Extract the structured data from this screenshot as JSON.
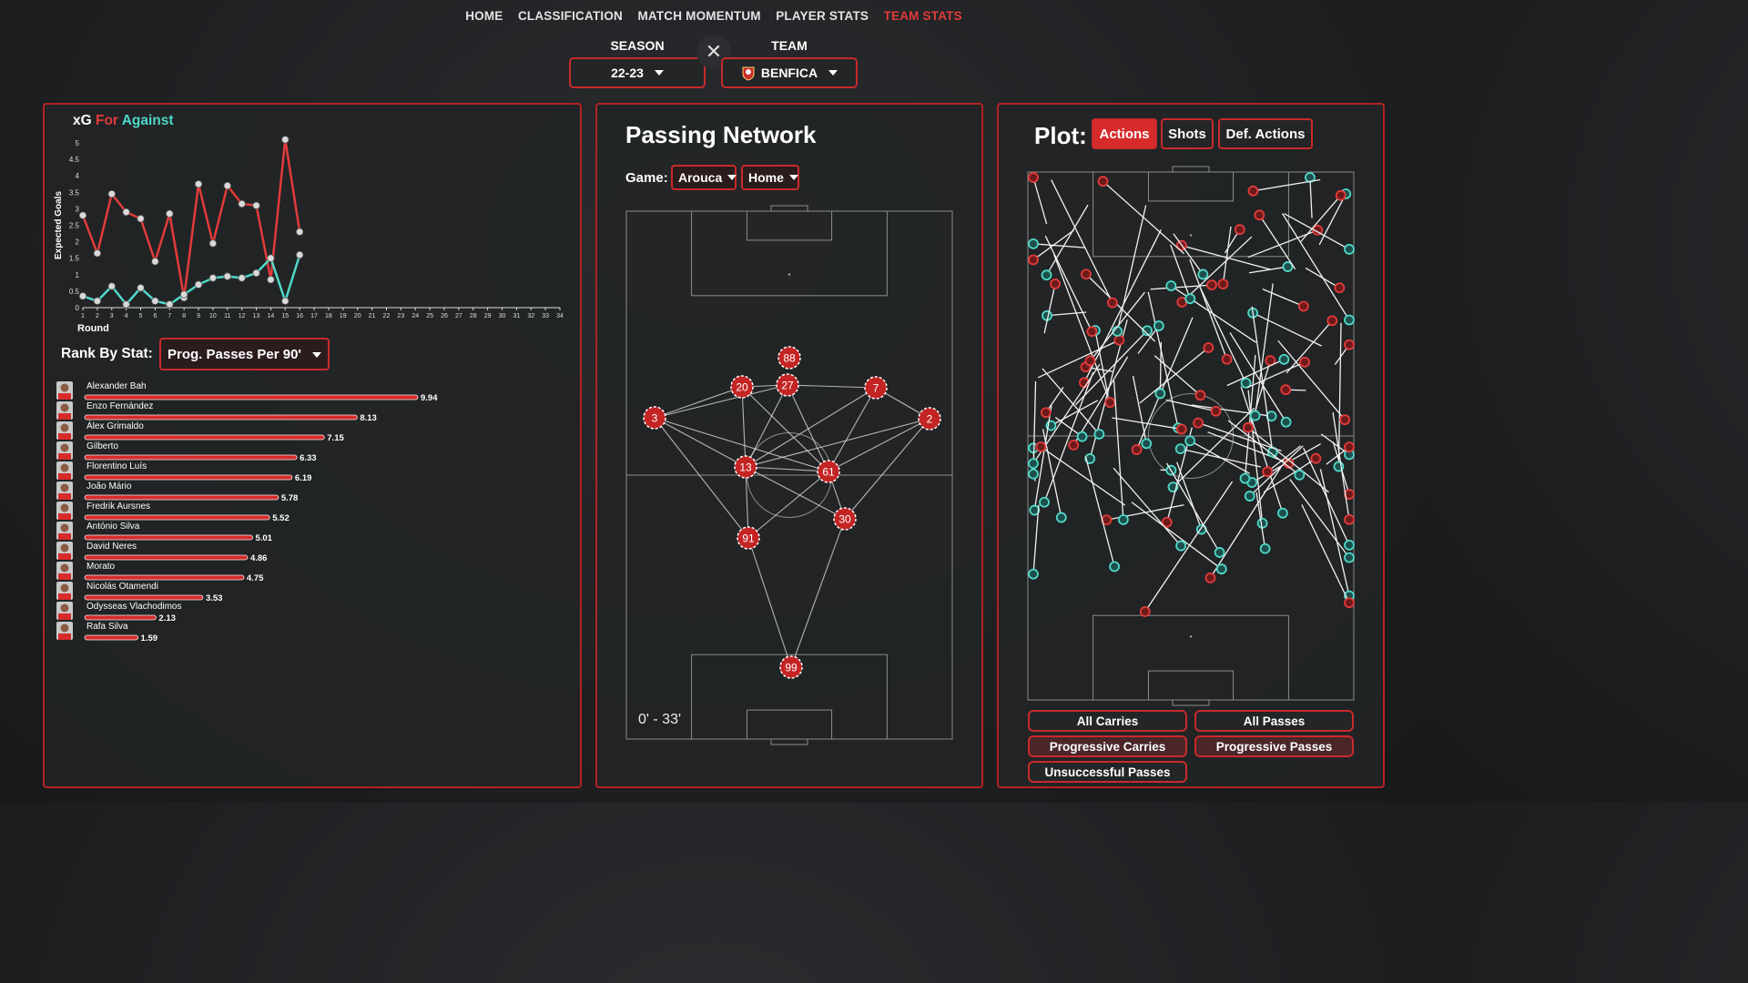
{
  "nav": {
    "items": [
      {
        "label": "HOME",
        "active": false
      },
      {
        "label": "CLASSIFICATION",
        "active": false
      },
      {
        "label": "MATCH MOMENTUM",
        "active": false
      },
      {
        "label": "PLAYER STATS",
        "active": false
      },
      {
        "label": "TEAM STATS",
        "active": true
      }
    ]
  },
  "filters": {
    "season_label": "SEASON",
    "season_value": "22-23",
    "team_label": "TEAM",
    "team_value": "BENFICA",
    "clear_symbol": "✕"
  },
  "colors": {
    "accent": "#d72b2b",
    "for": "#e23b3b",
    "against": "#4fd8c8",
    "panel_border": "#b32222"
  },
  "xg": {
    "title_prefix": "xG",
    "for_label": "For",
    "against_label": "Against",
    "ylabel": "Expected Goals",
    "xlabel": "Round"
  },
  "chart_data": {
    "type": "line",
    "x": [
      1,
      2,
      3,
      4,
      5,
      6,
      7,
      8,
      9,
      10,
      11,
      12,
      13,
      14,
      15,
      16
    ],
    "x_ticks": [
      1,
      2,
      3,
      4,
      5,
      6,
      7,
      8,
      9,
      10,
      11,
      12,
      13,
      14,
      15,
      16,
      17,
      18,
      19,
      20,
      21,
      22,
      23,
      24,
      25,
      26,
      27,
      28,
      29,
      30,
      31,
      32,
      33,
      34
    ],
    "y_ticks": [
      "0",
      "0.5",
      "1",
      "1.5",
      "2",
      "2.5",
      "3",
      "3.5",
      "4",
      "4.5",
      "5"
    ],
    "ylim": [
      0,
      5
    ],
    "xlim": [
      1,
      34
    ],
    "series": [
      {
        "name": "For",
        "values": [
          2.8,
          1.65,
          3.45,
          2.9,
          2.7,
          1.4,
          2.85,
          0.3,
          3.75,
          1.95,
          3.7,
          3.15,
          3.1,
          0.85,
          5.1,
          2.3
        ]
      },
      {
        "name": "Against",
        "values": [
          0.35,
          0.2,
          0.65,
          0.1,
          0.6,
          0.2,
          0.1,
          0.4,
          0.7,
          0.9,
          0.95,
          0.9,
          1.05,
          1.5,
          0.2,
          1.6
        ]
      }
    ]
  },
  "rank": {
    "label": "Rank By Stat:",
    "selected": "Prog. Passes Per 90'",
    "max": 9.94,
    "players": [
      {
        "name": "Alexander Bah",
        "value": 9.94
      },
      {
        "name": "Enzo Fernández",
        "value": 8.13
      },
      {
        "name": "Álex Grimaldo",
        "value": 7.15
      },
      {
        "name": "Gilberto",
        "value": 6.33
      },
      {
        "name": "Florentino Luís",
        "value": 6.19
      },
      {
        "name": "João Mário",
        "value": 5.78
      },
      {
        "name": "Fredrik Aursnes",
        "value": 5.52
      },
      {
        "name": "António Silva",
        "value": 5.01
      },
      {
        "name": "David Neres",
        "value": 4.86
      },
      {
        "name": "Morato",
        "value": 4.75
      },
      {
        "name": "Nicolás Otamendi",
        "value": 3.53
      },
      {
        "name": "Odysseas Vlachodimos",
        "value": 2.13
      },
      {
        "name": "Rafa Silva",
        "value": 1.59
      }
    ]
  },
  "passing": {
    "title": "Passing Network",
    "game_label": "Game:",
    "game_value": "Arouca",
    "venue_value": "Home",
    "time_range": "0' - 33'",
    "nodes": [
      {
        "num": "88"
      },
      {
        "num": "20"
      },
      {
        "num": "27"
      },
      {
        "num": "7"
      },
      {
        "num": "3"
      },
      {
        "num": "2"
      },
      {
        "num": "13"
      },
      {
        "num": "61"
      },
      {
        "num": "30"
      },
      {
        "num": "91"
      },
      {
        "num": "99"
      }
    ]
  },
  "plot": {
    "label": "Plot:",
    "tabs": [
      {
        "label": "Actions",
        "active": true
      },
      {
        "label": "Shots",
        "active": false
      },
      {
        "label": "Def. Actions",
        "active": false
      }
    ],
    "filters": [
      {
        "label": "All Carries",
        "active": false
      },
      {
        "label": "All Passes",
        "active": false
      },
      {
        "label": "Progressive Carries",
        "active": true
      },
      {
        "label": "Progressive Passes",
        "active": true
      },
      {
        "label": "Unsuccessful Passes",
        "active": false
      }
    ]
  }
}
